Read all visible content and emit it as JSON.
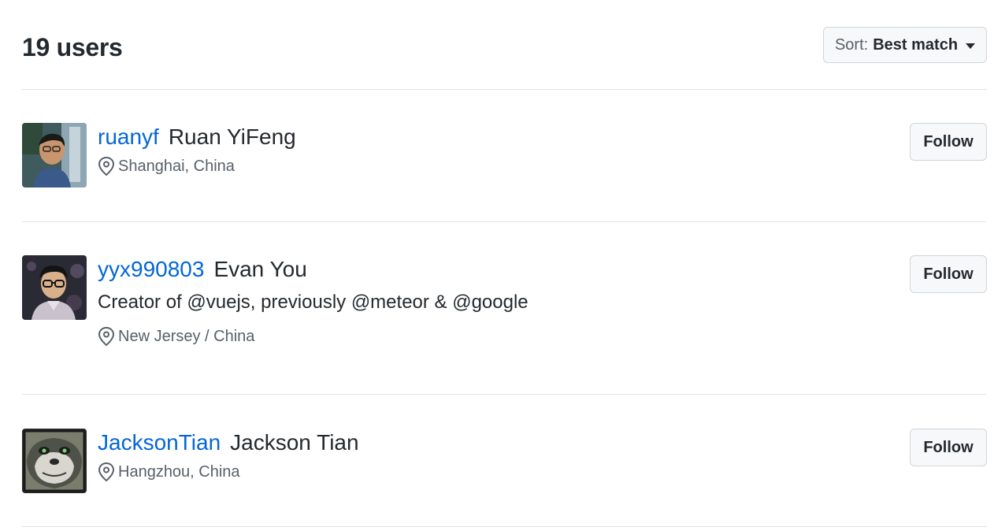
{
  "header": {
    "count_title": "19 users",
    "sort_prefix": "Sort:",
    "sort_value": "Best match"
  },
  "users": [
    {
      "login": "ruanyf",
      "name": "Ruan YiFeng",
      "bio": "",
      "location": "Shanghai, China",
      "follow_label": "Follow"
    },
    {
      "login": "yyx990803",
      "name": "Evan You",
      "bio": "Creator of @vuejs, previously @meteor & @google",
      "location": "New Jersey / China",
      "follow_label": "Follow"
    },
    {
      "login": "JacksonTian",
      "name": "Jackson Tian",
      "bio": "",
      "location": "Hangzhou, China",
      "follow_label": "Follow"
    }
  ],
  "colors": {
    "link": "#0366d6",
    "text": "#24292e",
    "muted": "#586069",
    "button_bg": "#f6f8fa",
    "border": "#d1d5da",
    "divider": "#e1e4e8"
  },
  "icons": {
    "location": "location-pin-icon",
    "sort_caret": "caret-down-icon"
  }
}
